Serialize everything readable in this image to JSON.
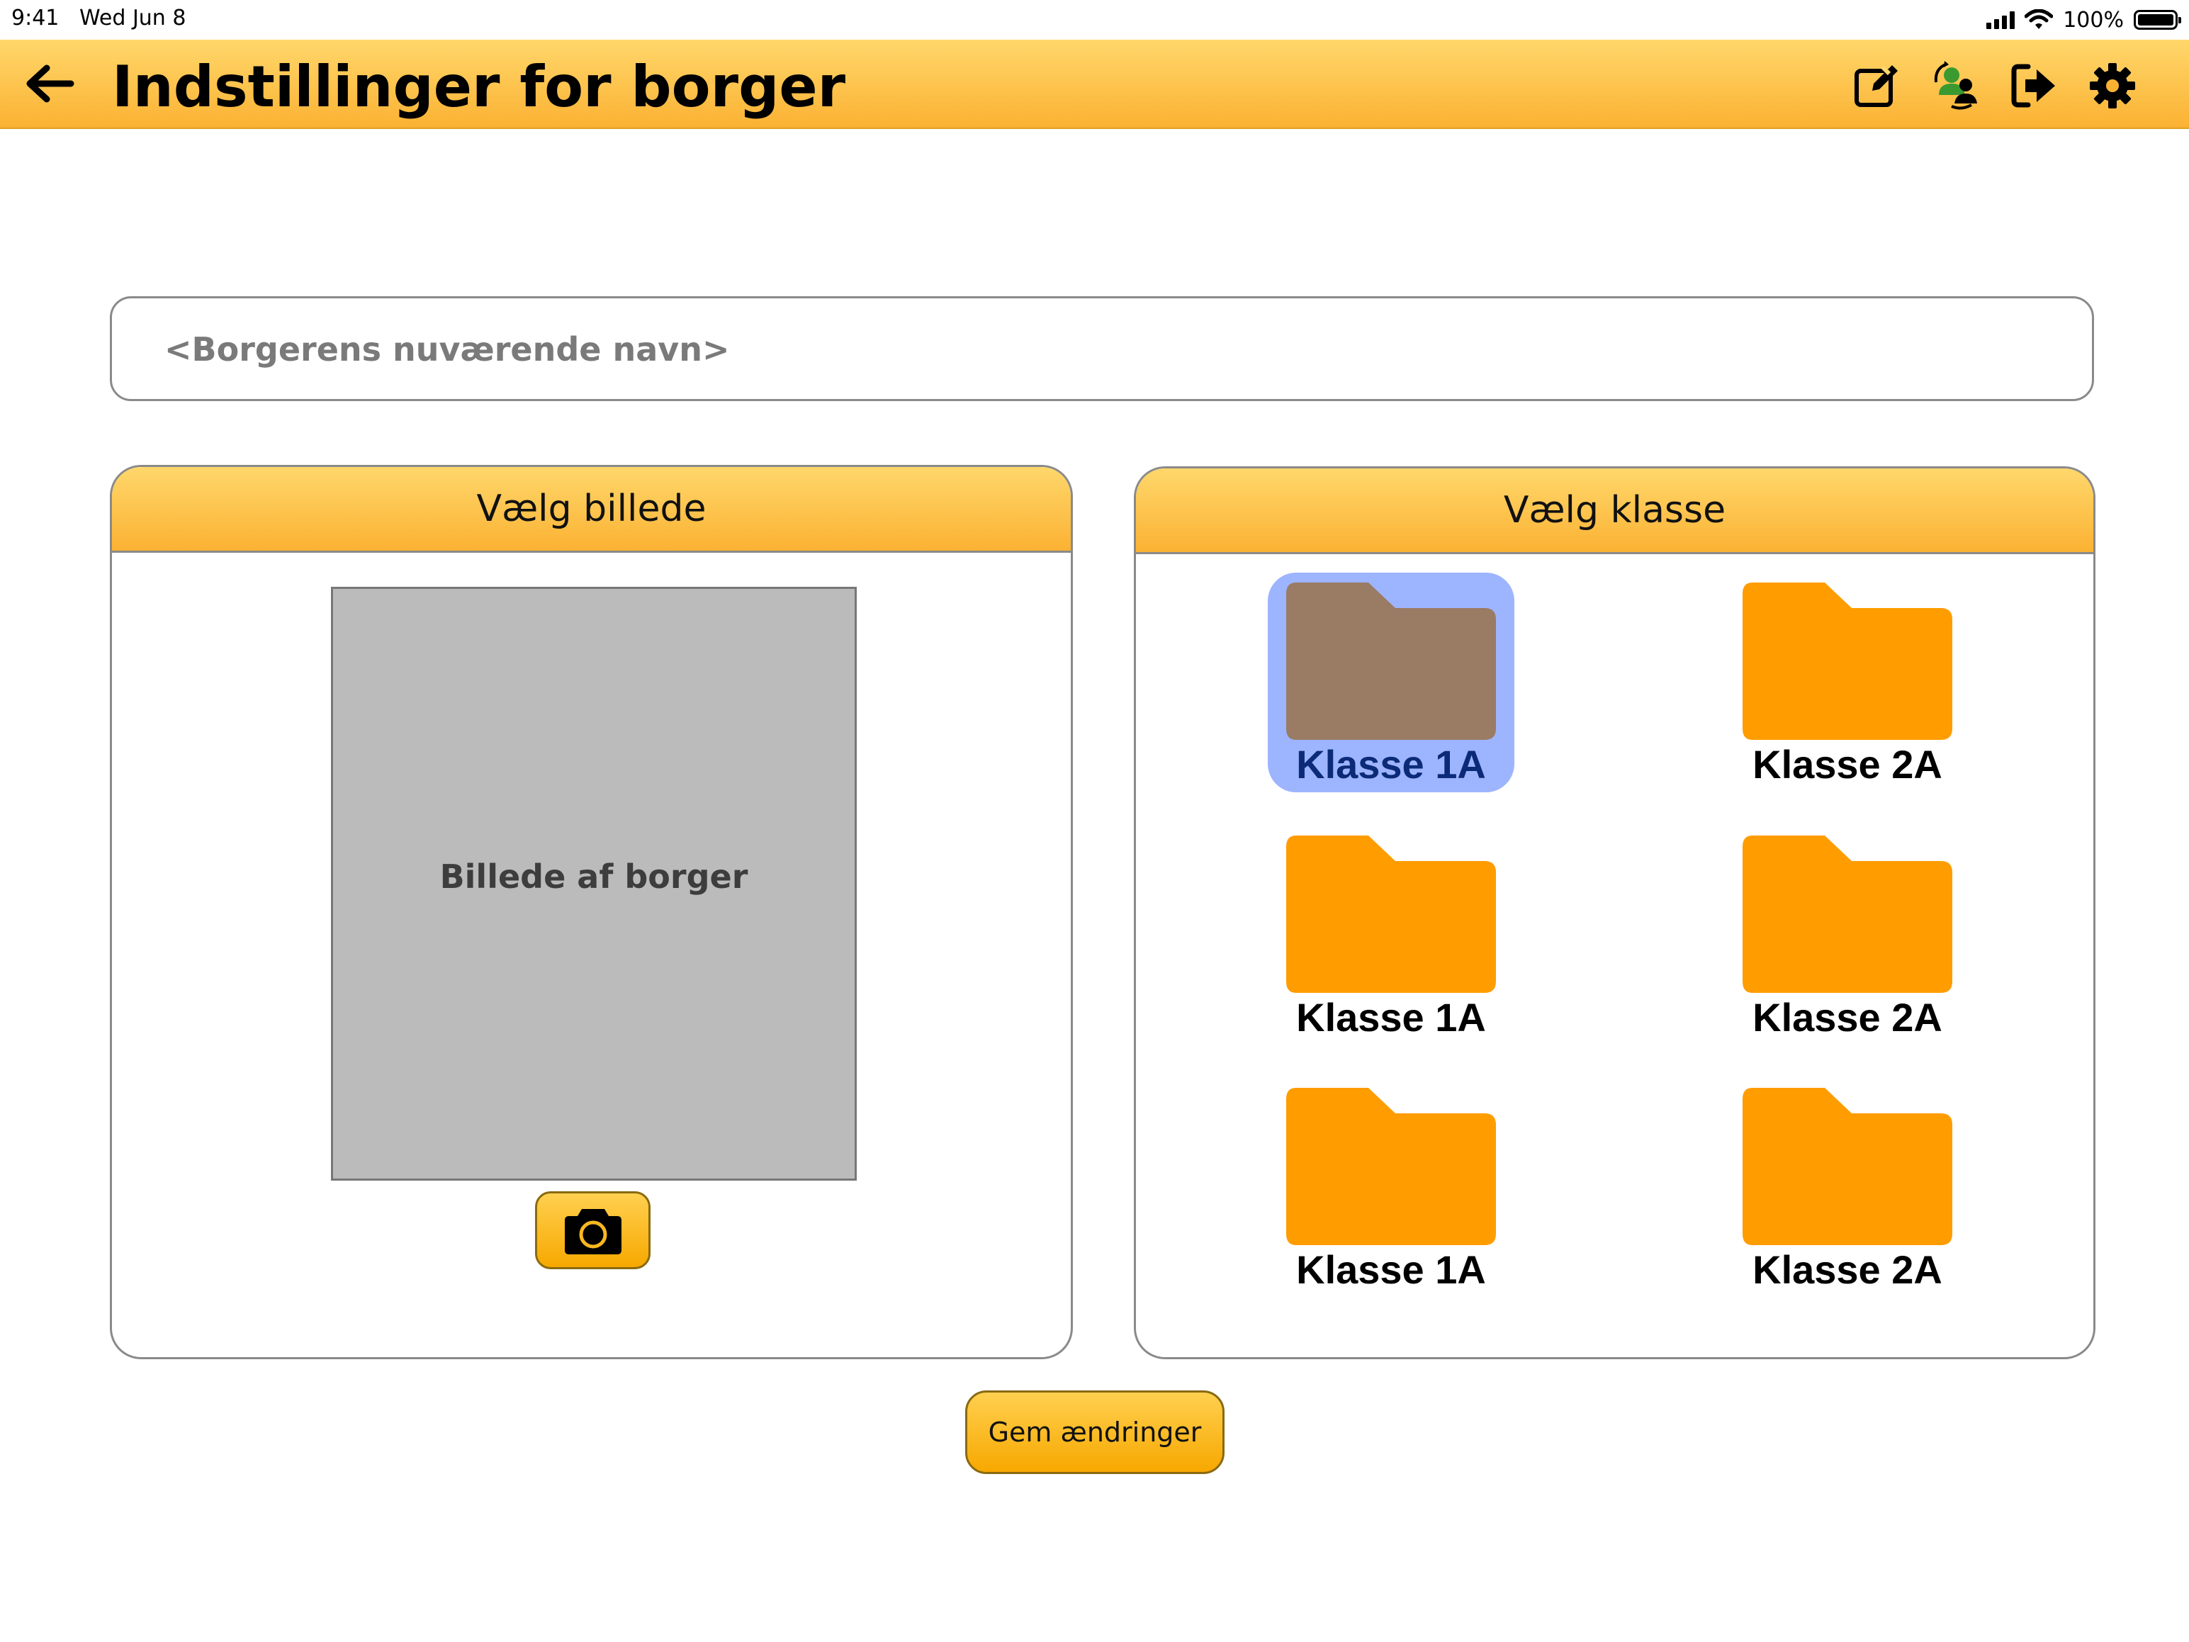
{
  "status_bar": {
    "time": "9:41",
    "date": "Wed Jun 8",
    "battery": "100%"
  },
  "header": {
    "title": "Indstillinger for borger",
    "icons": [
      "arrow-left-icon",
      "edit-icon",
      "switch-user-icon",
      "logout-icon",
      "gear-icon"
    ]
  },
  "name_field": {
    "placeholder": "<Borgerens nuværende navn>",
    "value": ""
  },
  "picture_panel": {
    "title": "Vælg billede",
    "photo_label": "Billede af borger",
    "camera_icon": "camera-icon"
  },
  "class_panel": {
    "title": "Vælg klasse",
    "folders": [
      {
        "label": "Klasse 1A",
        "selected": true
      },
      {
        "label": "Klasse 2A",
        "selected": false
      },
      {
        "label": "Klasse 1A",
        "selected": false
      },
      {
        "label": "Klasse 2A",
        "selected": false
      },
      {
        "label": "Klasse 1A",
        "selected": false
      },
      {
        "label": "Klasse 2A",
        "selected": false
      }
    ]
  },
  "save_button": {
    "label": "Gem ændringer"
  },
  "colors": {
    "header_top": "#ffd76b",
    "header_bottom": "#fbb233",
    "folder": "#ff9c00",
    "folder_selected": "#9a7b63",
    "selection_bg": "#9db4ff"
  }
}
